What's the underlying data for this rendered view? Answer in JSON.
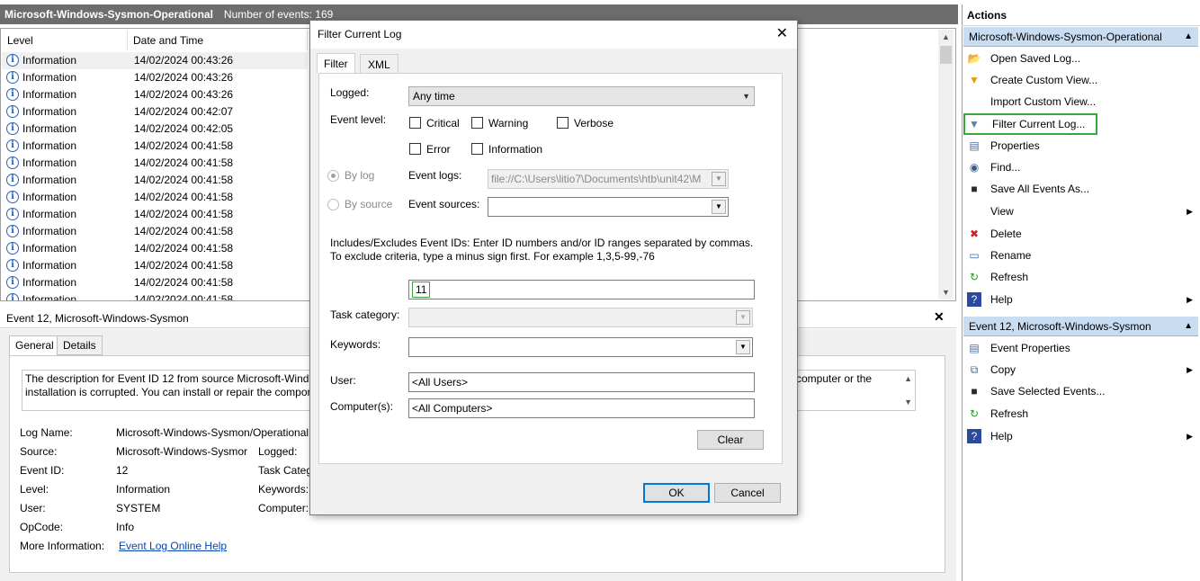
{
  "log": {
    "name": "Microsoft-Windows-Sysmon-Operational",
    "count_label": "Number of events: 169"
  },
  "grid": {
    "col_level": "Level",
    "col_date": "Date and Time",
    "rows": [
      {
        "level": "Information",
        "date": "14/02/2024 00:43:26"
      },
      {
        "level": "Information",
        "date": "14/02/2024 00:43:26"
      },
      {
        "level": "Information",
        "date": "14/02/2024 00:43:26"
      },
      {
        "level": "Information",
        "date": "14/02/2024 00:42:07"
      },
      {
        "level": "Information",
        "date": "14/02/2024 00:42:05"
      },
      {
        "level": "Information",
        "date": "14/02/2024 00:41:58"
      },
      {
        "level": "Information",
        "date": "14/02/2024 00:41:58"
      },
      {
        "level": "Information",
        "date": "14/02/2024 00:41:58"
      },
      {
        "level": "Information",
        "date": "14/02/2024 00:41:58"
      },
      {
        "level": "Information",
        "date": "14/02/2024 00:41:58"
      },
      {
        "level": "Information",
        "date": "14/02/2024 00:41:58"
      },
      {
        "level": "Information",
        "date": "14/02/2024 00:41:58"
      },
      {
        "level": "Information",
        "date": "14/02/2024 00:41:58"
      },
      {
        "level": "Information",
        "date": "14/02/2024 00:41:58"
      },
      {
        "level": "Information",
        "date": "14/02/2024 00:41:58"
      }
    ]
  },
  "details": {
    "header": "Event 12, Microsoft-Windows-Sysmon",
    "tab_general": "General",
    "tab_details": "Details",
    "desc_line1_left": "The description for Event ID 12 from source Microsoft-Windo",
    "desc_line1_right": "computer or the",
    "desc_line2": "installation is corrupted. You can install or repair the compor",
    "log_name_label": "Log Name:",
    "log_name_value": "Microsoft-Windows-Sysmon/Operational",
    "source_label": "Source:",
    "source_value": "Microsoft-Windows-Sysmor",
    "logged_label": "Logged:",
    "event_id_label": "Event ID:",
    "event_id_value": "12",
    "task_cat_label": "Task Categ",
    "level_label": "Level:",
    "level_value": "Information",
    "keywords_label": "Keywords:",
    "user_label": "User:",
    "user_value": "SYSTEM",
    "computer_label": "Computer:",
    "opcode_label": "OpCode:",
    "opcode_value": "Info",
    "more_info_label": "More Information:",
    "more_info_link": "Event Log Online Help"
  },
  "dialog": {
    "title": "Filter Current Log",
    "tab_filter": "Filter",
    "tab_xml": "XML",
    "logged_label": "Logged:",
    "logged_value": "Any time",
    "event_level_label": "Event level:",
    "levels": {
      "critical": "Critical",
      "warning": "Warning",
      "verbose": "Verbose",
      "error": "Error",
      "information": "Information"
    },
    "by_log": "By log",
    "by_source": "By source",
    "event_logs_label": "Event logs:",
    "event_logs_value": "file://C:\\Users\\litio7\\Documents\\htb\\unit42\\M",
    "event_sources_label": "Event sources:",
    "ids_help": "Includes/Excludes Event IDs: Enter ID numbers and/or ID ranges separated by commas. To exclude criteria, type a minus sign first. For example 1,3,5-99,-76",
    "ids_value": "11",
    "task_category_label": "Task category:",
    "keywords_label": "Keywords:",
    "user_label": "User:",
    "user_value": "<All Users>",
    "computers_label": "Computer(s):",
    "computers_value": "<All Computers>",
    "clear": "Clear",
    "ok": "OK",
    "cancel": "Cancel"
  },
  "actions": {
    "title": "Actions",
    "section1": "Microsoft-Windows-Sysmon-Operational",
    "items1": [
      "Open Saved Log...",
      "Create Custom View...",
      "Import Custom View...",
      "Filter Current Log...",
      "Properties",
      "Find...",
      "Save All Events As...",
      "View",
      "Delete",
      "Rename",
      "Refresh",
      "Help"
    ],
    "section2": "Event 12, Microsoft-Windows-Sysmon",
    "items2": [
      "Event Properties",
      "Copy",
      "Save Selected Events...",
      "Refresh",
      "Help"
    ],
    "highlight_color": "#3aa53a"
  }
}
